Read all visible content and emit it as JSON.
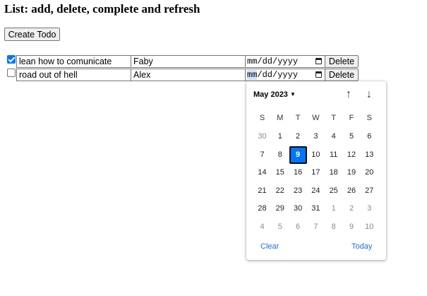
{
  "page": {
    "title": "List: add, delete, complete and refresh"
  },
  "toolbar": {
    "create_label": "Create Todo"
  },
  "todos": [
    {
      "done": true,
      "text": "lean how to comunicate",
      "owner": "Faby",
      "date": "mm/dd/yyyy",
      "delete_label": "Delete"
    },
    {
      "done": false,
      "text": "road out of hell",
      "owner": "Alex",
      "date": "mm/dd/yyyy",
      "delete_label": "Delete"
    }
  ],
  "date_placeholder": {
    "month": "mm",
    "sep1": "/",
    "day": "dd",
    "sep2": "/",
    "year": "yyyy"
  },
  "datepicker": {
    "month_label": "May 2023",
    "weekdays": [
      "S",
      "M",
      "T",
      "W",
      "T",
      "F",
      "S"
    ],
    "weeks": [
      [
        "30",
        "1",
        "2",
        "3",
        "4",
        "5",
        "6"
      ],
      [
        "7",
        "8",
        "9",
        "10",
        "11",
        "12",
        "13"
      ],
      [
        "14",
        "15",
        "16",
        "17",
        "18",
        "19",
        "20"
      ],
      [
        "21",
        "22",
        "23",
        "24",
        "25",
        "26",
        "27"
      ],
      [
        "28",
        "29",
        "30",
        "31",
        "1",
        "2",
        "3"
      ],
      [
        "4",
        "5",
        "6",
        "7",
        "8",
        "9",
        "10"
      ]
    ],
    "selected_day": "9",
    "clear_label": "Clear",
    "today_label": "Today",
    "up_icon": "arrow-up-icon",
    "down_icon": "arrow-down-icon",
    "accent_color": "#0075ff"
  }
}
